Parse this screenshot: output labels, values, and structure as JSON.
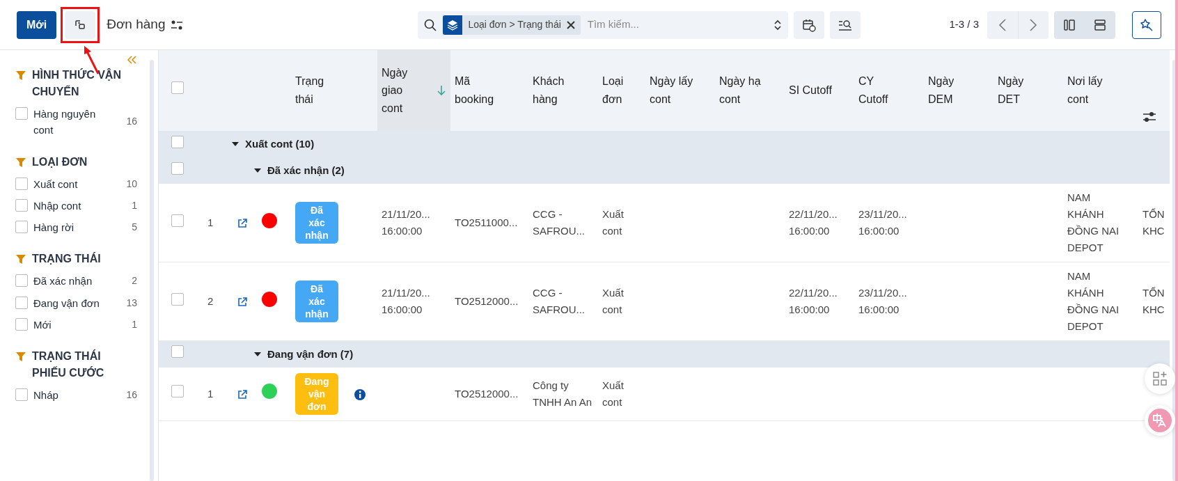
{
  "toolbar": {
    "new_label": "Mới",
    "title": "Đơn hàng",
    "facet": [
      "Loại đơn",
      "Trạng thái"
    ],
    "facet_separator": ">",
    "search_placeholder": "Tìm kiếm...",
    "pager": "1-3 / 3"
  },
  "sidebar": {
    "groups": [
      {
        "title": "HÌNH THỨC VẬN CHUYỂN",
        "items": [
          {
            "label": "Hàng nguyên cont",
            "count": "16",
            "checked": false
          }
        ]
      },
      {
        "title": "LOẠI ĐƠN",
        "items": [
          {
            "label": "Xuất cont",
            "count": "10",
            "checked": false
          },
          {
            "label": "Nhập cont",
            "count": "1",
            "checked": false
          },
          {
            "label": "Hàng rời",
            "count": "5",
            "checked": false
          }
        ]
      },
      {
        "title": "TRẠNG THÁI",
        "items": [
          {
            "label": "Đã xác nhận",
            "count": "2",
            "checked": false
          },
          {
            "label": "Đang vận đơn",
            "count": "13",
            "checked": false
          },
          {
            "label": "Mới",
            "count": "1",
            "checked": false
          }
        ]
      },
      {
        "title": "TRẠNG THÁI PHIẾU CƯỚC",
        "items": [
          {
            "label": "Nháp",
            "count": "16",
            "checked": false
          }
        ]
      }
    ]
  },
  "table": {
    "select_all_checked": false,
    "columns": [
      {
        "label": "Trạng thái",
        "sorted": false
      },
      {
        "label": "Ngày giao cont",
        "sorted": true
      },
      {
        "label": "Mã booking",
        "sorted": false
      },
      {
        "label": "Khách hàng",
        "sorted": false
      },
      {
        "label": "Loại đơn",
        "sorted": false
      },
      {
        "label": "Ngày lấy cont",
        "sorted": false
      },
      {
        "label": "Ngày hạ cont",
        "sorted": false
      },
      {
        "label": "SI Cutoff",
        "sorted": false
      },
      {
        "label": "CY Cutoff",
        "sorted": false
      },
      {
        "label": "Ngày DEM",
        "sorted": false
      },
      {
        "label": "Ngày DET",
        "sorted": false
      },
      {
        "label": "Nơi lấy cont",
        "sorted": false
      }
    ],
    "groups": [
      {
        "label": "Xuất cont (10)",
        "expanded": true,
        "checked": false,
        "children": [
          {
            "label": "Đã xác nhận (2)",
            "expanded": true,
            "checked": false,
            "rows": [
              {
                "index": "1",
                "checked": false,
                "color": "#ff0000",
                "status": {
                  "label": "Đã xác nhận",
                  "kind": "confirmed"
                },
                "has_info": false,
                "cells": [
                  "21/11/20... 16:00:00",
                  "TO2511000...",
                  "CCG - SAFROU...",
                  "Xuất cont",
                  null,
                  null,
                  "22/11/20... 16:00:00",
                  "23/11/20... 16:00:00",
                  null,
                  null,
                  "NAM KHÁNH ĐỒNG NAI DEPOT",
                  "TỔN KHC"
                ]
              },
              {
                "index": "2",
                "checked": false,
                "color": "#ff0000",
                "status": {
                  "label": "Đã xác nhận",
                  "kind": "confirmed"
                },
                "has_info": false,
                "cells": [
                  "21/11/20... 16:00:00",
                  "TO2512000...",
                  "CCG - SAFROU...",
                  "Xuất cont",
                  null,
                  null,
                  "22/11/20... 16:00:00",
                  "23/11/20... 16:00:00",
                  null,
                  null,
                  "NAM KHÁNH ĐỒNG NAI DEPOT",
                  "TỔN KHC"
                ]
              }
            ]
          },
          {
            "label": "Đang vận đơn (7)",
            "expanded": true,
            "checked": false,
            "rows": [
              {
                "index": "1",
                "checked": false,
                "color": "#2ed158",
                "status": {
                  "label": "Đang vận đơn",
                  "kind": "shipping"
                },
                "has_info": true,
                "cells": [
                  null,
                  "TO2512000...",
                  "Công ty TNHH An An",
                  "Xuất cont",
                  null,
                  null,
                  null,
                  null,
                  null,
                  null,
                  null,
                  null
                ]
              }
            ]
          }
        ]
      }
    ]
  }
}
